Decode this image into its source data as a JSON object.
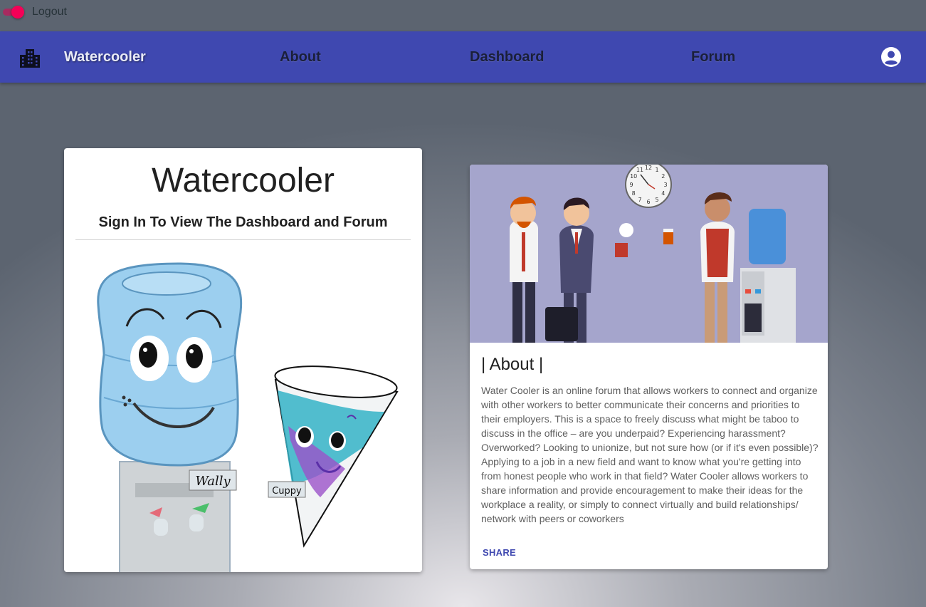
{
  "top": {
    "logout_label": "Logout"
  },
  "colors": {
    "appbar": "#3f48b0",
    "toggle": "#f50057",
    "share": "#3f48b0"
  },
  "appbar": {
    "logo_icon": "building-icon",
    "brand": "Watercooler",
    "nav": {
      "about": "About",
      "dashboard": "Dashboard",
      "forum": "Forum"
    },
    "account_icon": "account-circle-icon"
  },
  "signin_card": {
    "title": "Watercooler",
    "subtitle": "Sign In To View The Dashboard and Forum",
    "illustration": {
      "bottle_tag": "Wally",
      "cup_tag": "Cuppy"
    }
  },
  "about_card": {
    "heading": "| About |",
    "body": "Water Cooler is an online forum that allows workers to connect and organize with other workers to better communicate their concerns and priorities to their employers. This is a space to freely discuss what might be taboo to discuss in the office – are you underpaid? Experiencing harassment? Overworked? Looking to unionize, but not sure how (or if it's even possible)? Applying to a job in a new field and want to know what you're getting into from honest people who work in that field? Water Cooler allows workers to share information and provide encouragement to make their ideas for the workplace a reality, or simply to connect virtually and build relationships/ network with peers or coworkers",
    "share_label": "SHARE",
    "clock_numbers": [
      "12",
      "1",
      "2",
      "3",
      "4",
      "5",
      "6",
      "7",
      "8",
      "9",
      "10",
      "11"
    ]
  }
}
